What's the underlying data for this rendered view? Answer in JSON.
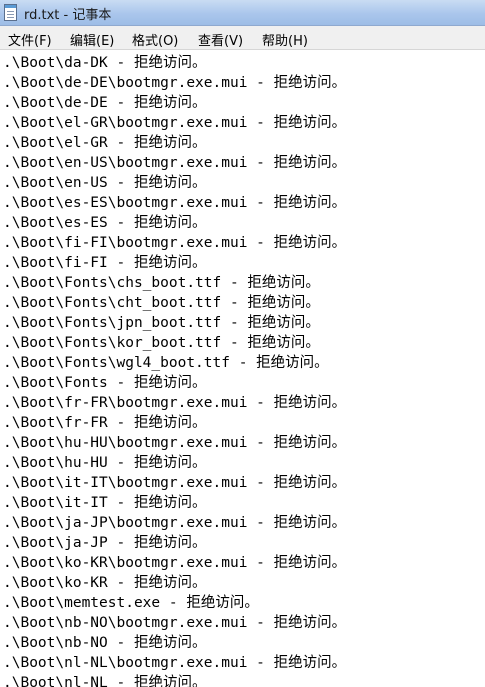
{
  "window": {
    "title": "rd.txt - 记事本",
    "app_icon": "notepad-icon"
  },
  "menu": [
    {
      "id": "file",
      "label": "文件(F)"
    },
    {
      "id": "edit",
      "label": "编辑(E)"
    },
    {
      "id": "format",
      "label": "格式(O)"
    },
    {
      "id": "view",
      "label": "查看(V)"
    },
    {
      "id": "help",
      "label": "帮助(H)"
    }
  ],
  "document": {
    "lines": [
      ".\\Boot\\da-DK - 拒绝访问。",
      ".\\Boot\\de-DE\\bootmgr.exe.mui - 拒绝访问。",
      ".\\Boot\\de-DE - 拒绝访问。",
      ".\\Boot\\el-GR\\bootmgr.exe.mui - 拒绝访问。",
      ".\\Boot\\el-GR - 拒绝访问。",
      ".\\Boot\\en-US\\bootmgr.exe.mui - 拒绝访问。",
      ".\\Boot\\en-US - 拒绝访问。",
      ".\\Boot\\es-ES\\bootmgr.exe.mui - 拒绝访问。",
      ".\\Boot\\es-ES - 拒绝访问。",
      ".\\Boot\\fi-FI\\bootmgr.exe.mui - 拒绝访问。",
      ".\\Boot\\fi-FI - 拒绝访问。",
      ".\\Boot\\Fonts\\chs_boot.ttf - 拒绝访问。",
      ".\\Boot\\Fonts\\cht_boot.ttf - 拒绝访问。",
      ".\\Boot\\Fonts\\jpn_boot.ttf - 拒绝访问。",
      ".\\Boot\\Fonts\\kor_boot.ttf - 拒绝访问。",
      ".\\Boot\\Fonts\\wgl4_boot.ttf - 拒绝访问。",
      ".\\Boot\\Fonts - 拒绝访问。",
      ".\\Boot\\fr-FR\\bootmgr.exe.mui - 拒绝访问。",
      ".\\Boot\\fr-FR - 拒绝访问。",
      ".\\Boot\\hu-HU\\bootmgr.exe.mui - 拒绝访问。",
      ".\\Boot\\hu-HU - 拒绝访问。",
      ".\\Boot\\it-IT\\bootmgr.exe.mui - 拒绝访问。",
      ".\\Boot\\it-IT - 拒绝访问。",
      ".\\Boot\\ja-JP\\bootmgr.exe.mui - 拒绝访问。",
      ".\\Boot\\ja-JP - 拒绝访问。",
      ".\\Boot\\ko-KR\\bootmgr.exe.mui - 拒绝访问。",
      ".\\Boot\\ko-KR - 拒绝访问。",
      ".\\Boot\\memtest.exe - 拒绝访问。",
      ".\\Boot\\nb-NO\\bootmgr.exe.mui - 拒绝访问。",
      ".\\Boot\\nb-NO - 拒绝访问。",
      ".\\Boot\\nl-NL\\bootmgr.exe.mui - 拒绝访问。",
      ".\\Boot\\nl-NL - 拒绝访问。"
    ]
  }
}
